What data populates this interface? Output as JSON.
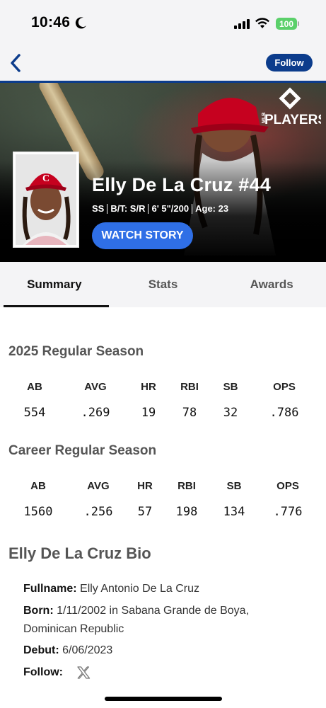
{
  "status_bar": {
    "time": "10:46",
    "battery": "100"
  },
  "nav": {
    "follow_label": "Follow"
  },
  "hero": {
    "brand_small": "MLB",
    "brand": "PLAYERS",
    "player_name": "Elly De La Cruz #44",
    "meta": [
      "SS",
      "B/T: S/R",
      "6' 5\"/200",
      "Age: 23"
    ],
    "watch_story_label": "WATCH STORY",
    "accent_color": "#2f6fe6",
    "team_color": "#c6011f"
  },
  "tabs": [
    {
      "label": "Summary",
      "active": true
    },
    {
      "label": "Stats",
      "active": false
    },
    {
      "label": "Awards",
      "active": false
    }
  ],
  "season": {
    "title": "2025 Regular Season",
    "headers": [
      "AB",
      "AVG",
      "HR",
      "RBI",
      "SB",
      "OPS"
    ],
    "values": [
      "554",
      ".269",
      "19",
      "78",
      "32",
      ".786"
    ]
  },
  "career": {
    "title": "Career Regular Season",
    "headers": [
      "AB",
      "AVG",
      "HR",
      "RBI",
      "SB",
      "OPS"
    ],
    "values": [
      "1560",
      ".256",
      "57",
      "198",
      "134",
      ".776"
    ]
  },
  "bio": {
    "title": "Elly De La Cruz Bio",
    "fullname_label": "Fullname:",
    "fullname": "Elly Antonio De La Cruz",
    "born_label": "Born:",
    "born_line1": "1/11/2002 in Sabana Grande de Boya,",
    "born_line2": "Dominican Republic",
    "debut_label": "Debut:",
    "debut": "6/06/2023",
    "follow_label": "Follow:",
    "follow_icon": "x-icon"
  }
}
